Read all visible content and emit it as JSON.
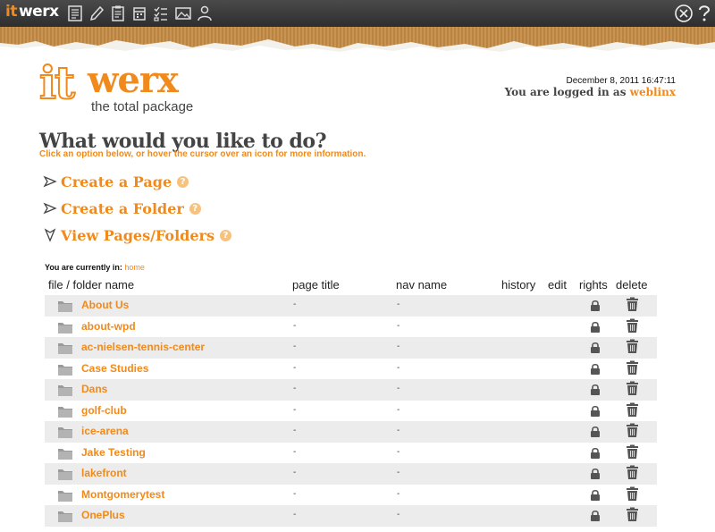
{
  "toolbar": {
    "logo_it": "it",
    "logo_werx": "werx",
    "icons": [
      "pages-icon",
      "edit-icon",
      "clipboard-icon",
      "calendar-icon",
      "checklist-icon",
      "image-icon",
      "user-icon"
    ],
    "right_icons": [
      "exit-icon",
      "help-icon"
    ]
  },
  "brand": {
    "logo_it": "it",
    "logo_werx": "werx",
    "tagline": "the total package",
    "accent": "#f08a1c"
  },
  "session": {
    "datetime": "December 8, 2011 16:47:11",
    "logged_in_prefix": "You are logged in as ",
    "username": "weblinx"
  },
  "main": {
    "heading": "What would you like to do?",
    "subheading": "Click an option below, or hover the cursor over an icon for more information.",
    "actions": [
      {
        "label": "Create a Page",
        "icon": "arrow-right-icon"
      },
      {
        "label": "Create a Folder",
        "icon": "arrow-right-icon"
      },
      {
        "label": "View Pages/Folders",
        "icon": "arrow-down-icon"
      }
    ],
    "help_glyph": "?"
  },
  "listing": {
    "location_label": "You are currently in:",
    "location": "home",
    "columns": [
      "file / folder name",
      "page title",
      "nav name",
      "history",
      "edit",
      "rights",
      "delete"
    ],
    "rows": [
      {
        "name": "About Us",
        "page_title": "-",
        "nav_name": "-"
      },
      {
        "name": "about-wpd",
        "page_title": "-",
        "nav_name": "-"
      },
      {
        "name": "ac-nielsen-tennis-center",
        "page_title": "-",
        "nav_name": "-"
      },
      {
        "name": "Case Studies",
        "page_title": "-",
        "nav_name": "-"
      },
      {
        "name": "Dans",
        "page_title": "-",
        "nav_name": "-"
      },
      {
        "name": "golf-club",
        "page_title": "-",
        "nav_name": "-"
      },
      {
        "name": "ice-arena",
        "page_title": "-",
        "nav_name": "-"
      },
      {
        "name": "Jake Testing",
        "page_title": "-",
        "nav_name": "-"
      },
      {
        "name": "lakefront",
        "page_title": "-",
        "nav_name": "-"
      },
      {
        "name": "Montgomerytest",
        "page_title": "-",
        "nav_name": "-"
      },
      {
        "name": "OnePlus",
        "page_title": "-",
        "nav_name": "-"
      }
    ]
  }
}
